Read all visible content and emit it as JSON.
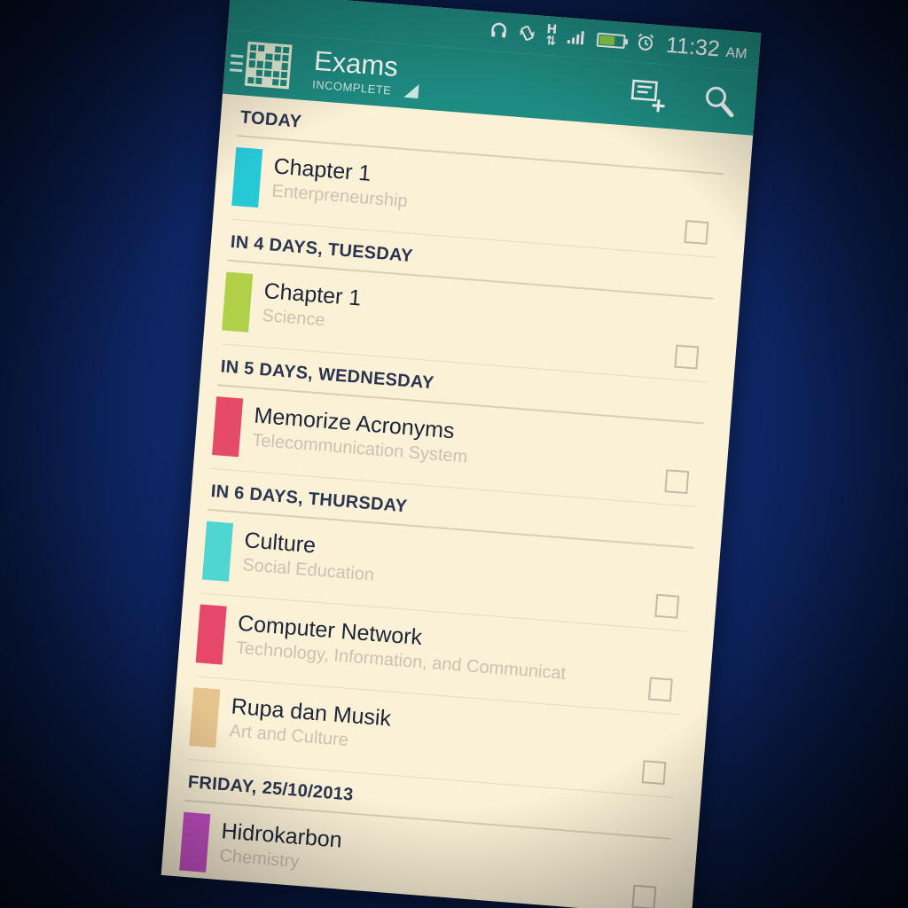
{
  "status_bar": {
    "time": "11:32",
    "ampm": "AM",
    "network": "H",
    "icons": [
      "headset-icon",
      "vibrate-icon",
      "data-arrows-icon",
      "signal-icon",
      "battery-icon",
      "alarm-icon"
    ]
  },
  "app_bar": {
    "title": "Exams",
    "filter": "INCOMPLETE",
    "actions": [
      "add-list-icon",
      "search-icon"
    ]
  },
  "colors": {
    "app_bar": "#1f8c82",
    "background": "#fbf1d6",
    "section_header": "#2a3550"
  },
  "sections": [
    {
      "header": "TODAY",
      "items": [
        {
          "title": "Chapter 1",
          "subtitle": "Enterpreneurship",
          "color": "#27c8d6"
        }
      ]
    },
    {
      "header": "IN 4 DAYS, TUESDAY",
      "items": [
        {
          "title": "Chapter 1",
          "subtitle": "Science",
          "color": "#b0d04a"
        }
      ]
    },
    {
      "header": "IN 5 DAYS, WEDNESDAY",
      "items": [
        {
          "title": "Memorize Acronyms",
          "subtitle": "Telecommunication System",
          "color": "#e54b66"
        }
      ]
    },
    {
      "header": "IN 6 DAYS, THURSDAY",
      "items": [
        {
          "title": "Culture",
          "subtitle": "Social Education",
          "color": "#4fd6d2"
        },
        {
          "title": "Computer Network",
          "subtitle": "Technology, Information, and Communicat",
          "color": "#e5486a"
        },
        {
          "title": "Rupa dan Musik",
          "subtitle": "Art and Culture",
          "color": "#e6c48e"
        }
      ]
    },
    {
      "header": "FRIDAY, 25/10/2013",
      "items": [
        {
          "title": "Hidrokarbon",
          "subtitle": "Chemistry",
          "color": "#c44fc4"
        }
      ]
    }
  ]
}
